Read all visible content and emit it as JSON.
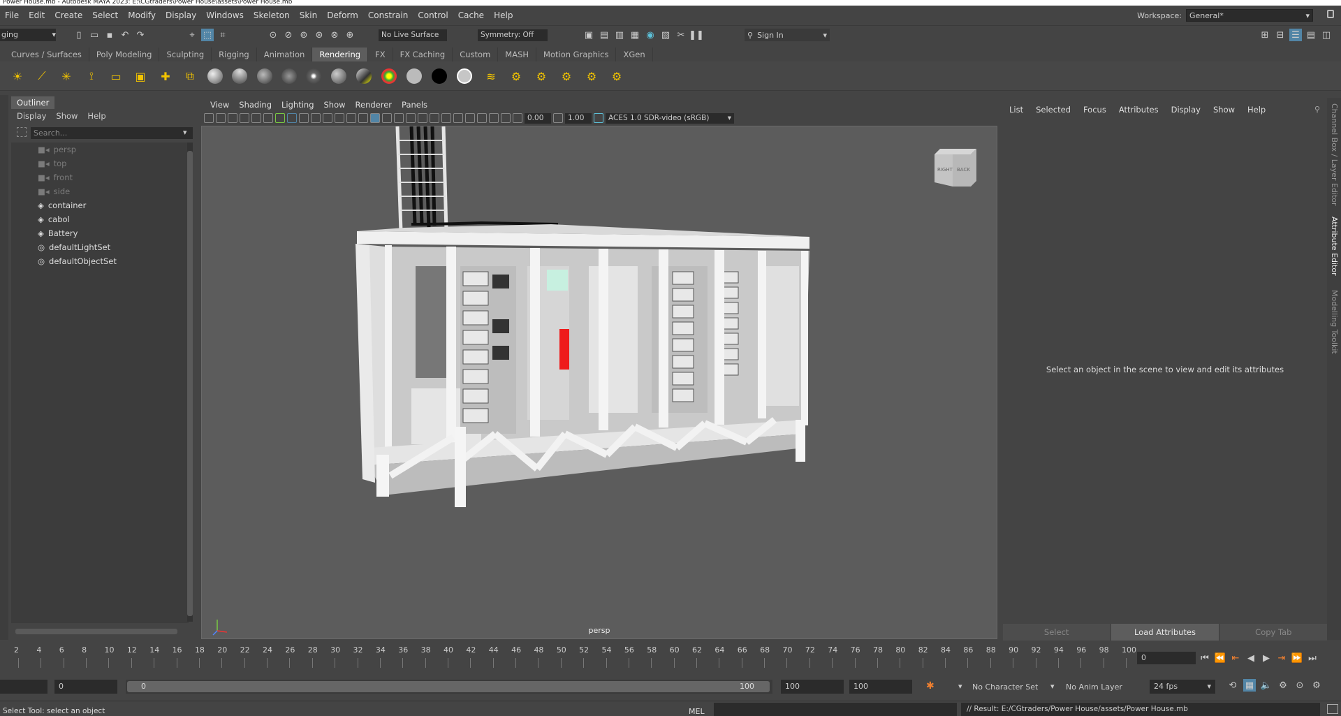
{
  "window": {
    "title": "Power House.mb - Autodesk MAYA 2023: E:\\CGtraders\\Power House\\assets\\Power House.mb"
  },
  "menubar": [
    "File",
    "Edit",
    "Create",
    "Select",
    "Modify",
    "Display",
    "Windows",
    "Skeleton",
    "Skin",
    "Deform",
    "Constrain",
    "Control",
    "Cache",
    "Help"
  ],
  "workspace": {
    "label": "Workspace:",
    "value": "General*"
  },
  "statusline": {
    "mode": "ging",
    "live_surface": "No Live Surface",
    "symmetry": "Symmetry: Off",
    "sign_in": "Sign In"
  },
  "shelf_tabs": [
    "Curves / Surfaces",
    "Poly Modeling",
    "Sculpting",
    "Rigging",
    "Animation",
    "Rendering",
    "FX",
    "FX Caching",
    "Custom",
    "MASH",
    "Motion Graphics",
    "XGen"
  ],
  "shelf_active": "Rendering",
  "outliner": {
    "title": "Outliner",
    "menu": [
      "Display",
      "Show",
      "Help"
    ],
    "search_placeholder": "Search...",
    "items": [
      {
        "label": "persp",
        "kind": "camera",
        "dim": true
      },
      {
        "label": "top",
        "kind": "camera",
        "dim": true
      },
      {
        "label": "front",
        "kind": "camera",
        "dim": true
      },
      {
        "label": "side",
        "kind": "camera",
        "dim": true
      },
      {
        "label": "container",
        "kind": "group",
        "dim": false
      },
      {
        "label": "cabol",
        "kind": "group",
        "dim": false
      },
      {
        "label": "Battery",
        "kind": "group",
        "dim": false
      },
      {
        "label": "defaultLightSet",
        "kind": "set",
        "dim": false
      },
      {
        "label": "defaultObjectSet",
        "kind": "set",
        "dim": false
      }
    ]
  },
  "viewport": {
    "menu": [
      "View",
      "Shading",
      "Lighting",
      "Show",
      "Renderer",
      "Panels"
    ],
    "exposure": "0.00",
    "gamma": "1.00",
    "color_space": "ACES 1.0 SDR-video (sRGB)",
    "camera_label": "persp",
    "viewcube": {
      "left": "RIGHT",
      "right": "BACK"
    }
  },
  "attribute_editor": {
    "menu": [
      "List",
      "Selected",
      "Focus",
      "Attributes",
      "Display",
      "Show",
      "Help"
    ],
    "message": "Select an object in the scene to view and edit its attributes",
    "buttons": [
      "Select",
      "Load Attributes",
      "Copy Tab"
    ],
    "side_tabs": [
      "Channel Box / Layer Editor",
      "Attribute Editor",
      "Modelling Toolkit"
    ]
  },
  "timeslider": {
    "ticks": [
      "2",
      "4",
      "6",
      "8",
      "10",
      "12",
      "14",
      "16",
      "18",
      "20",
      "22",
      "24",
      "26",
      "28",
      "30",
      "32",
      "34",
      "36",
      "38",
      "40",
      "42",
      "44",
      "46",
      "48",
      "50",
      "52",
      "54",
      "56",
      "58",
      "60",
      "62",
      "64",
      "66",
      "68",
      "70",
      "72",
      "74",
      "76",
      "78",
      "80",
      "82",
      "84",
      "86",
      "88",
      "90",
      "92",
      "94",
      "96",
      "98",
      "100"
    ],
    "current_frame": "0"
  },
  "range": {
    "start": "0",
    "inner_start": "0",
    "inner_end": "100",
    "end1": "100",
    "end2": "100",
    "character_set": "No Character Set",
    "anim_layer": "No Anim Layer",
    "fps": "24 fps"
  },
  "cmdline": {
    "help": "Select Tool: select an object",
    "mel_label": "MEL",
    "result": "// Result: E:/CGtraders/Power House/assets/Power House.mb"
  }
}
